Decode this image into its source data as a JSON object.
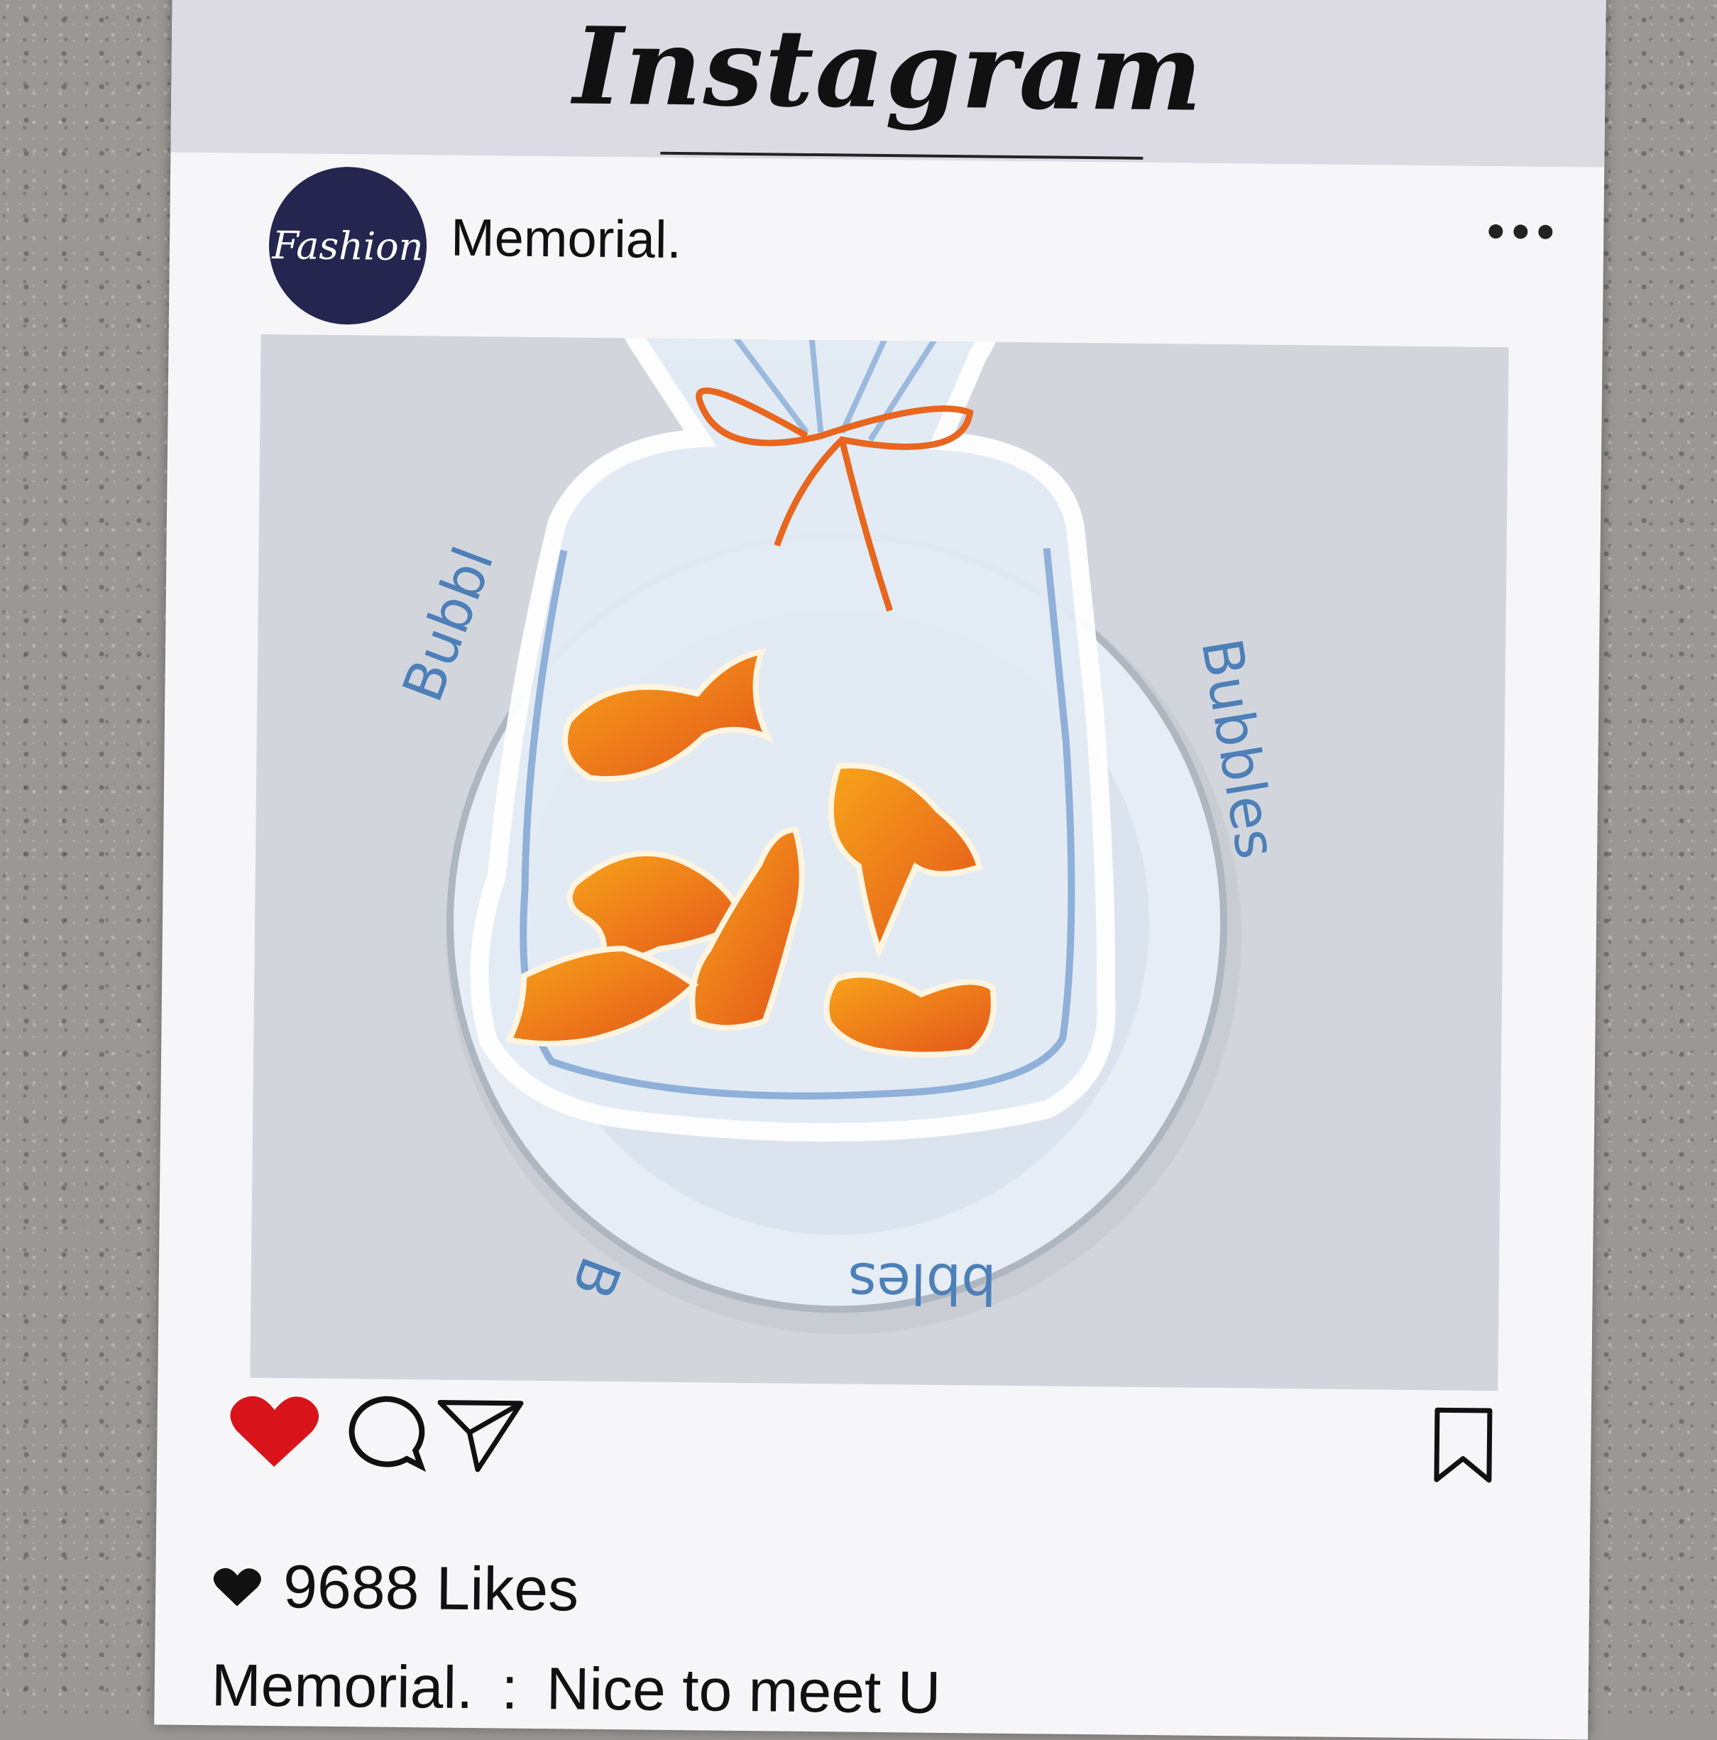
{
  "header": {
    "app_title": "Instagram"
  },
  "post": {
    "avatar_text": "Fashion",
    "username": "Memorial.",
    "more_icon": "more-dots-icon",
    "photo_labels": {
      "top_left": "Bubbl",
      "right": "Bubbles",
      "bottom_left": "B",
      "bottom_right": "bbles"
    }
  },
  "actions": {
    "like_icon": "heart-icon",
    "comment_icon": "comment-bubble-icon",
    "share_icon": "paper-plane-icon",
    "bookmark_icon": "bookmark-icon"
  },
  "likes": {
    "text": "9688 Likes"
  },
  "caption": {
    "user": "Memorial.",
    "separator": ":",
    "text": "Nice to meet U"
  },
  "colors": {
    "heart": "#d8141a",
    "avatar": "#242650",
    "card": "#f6f6f8",
    "band": "#dcdbe3"
  }
}
